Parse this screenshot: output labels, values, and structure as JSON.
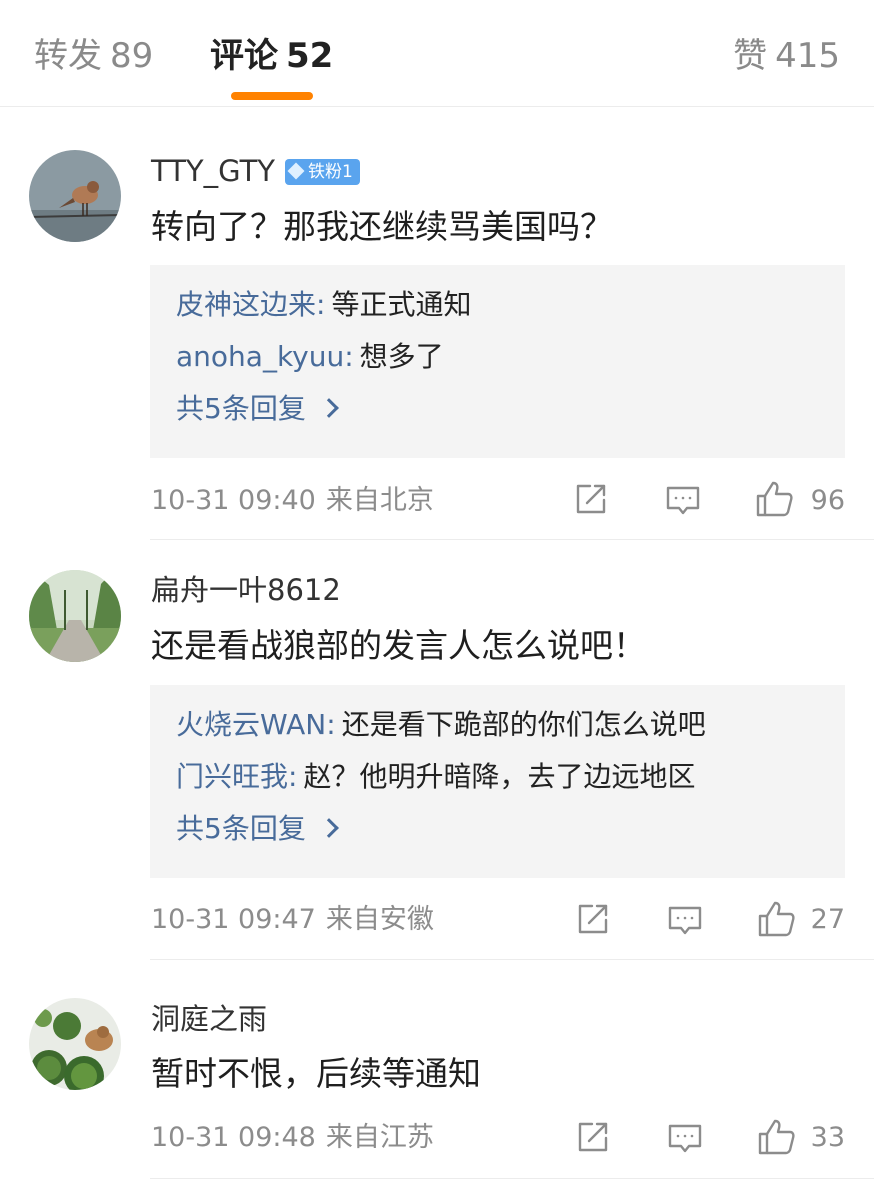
{
  "tabs": {
    "forward": {
      "label": "转发",
      "count": "89"
    },
    "comments": {
      "label": "评论",
      "count": "52"
    },
    "likes": {
      "label": "赞",
      "count": "415"
    }
  },
  "colors": {
    "accent": "#ff8200",
    "link": "#486b9a",
    "badge": "#5aa4ee",
    "reply_bg": "#f4f4f4"
  },
  "comments": [
    {
      "username": "TTY_GTY",
      "badge": "铁粉1",
      "text": "转向了？那我还继续骂美国吗？",
      "replies": [
        {
          "name": "皮神这边来",
          "colon": ":",
          "text": "等正式通知"
        },
        {
          "name": "anoha_kyuu",
          "colon": ":",
          "text": "想多了"
        }
      ],
      "more": "共5条回复",
      "time": "10-31 09:40",
      "source": "来自北京",
      "likes": "96"
    },
    {
      "username": "扁舟一叶8612",
      "text": "还是看战狼部的发言人怎么说吧！",
      "replies": [
        {
          "name": "火烧云WAN",
          "colon": ":",
          "text": "还是看下跪部的你们怎么说吧"
        },
        {
          "name": "门兴旺我",
          "colon": ":",
          "text": "赵？他明升暗降，去了边远地区"
        }
      ],
      "more": "共5条回复",
      "time": "10-31 09:47",
      "source": "来自安徽",
      "likes": "27"
    },
    {
      "username": "洞庭之雨",
      "text": "暂时不恨，后续等通知",
      "time": "10-31 09:48",
      "source": "来自江苏",
      "likes": "33"
    }
  ],
  "icons": {
    "repost": "repost-icon",
    "comment": "comment-icon",
    "like": "thumbs-up-icon",
    "chevron": "chevron-right-icon",
    "badge_gem": "diamond-icon"
  }
}
